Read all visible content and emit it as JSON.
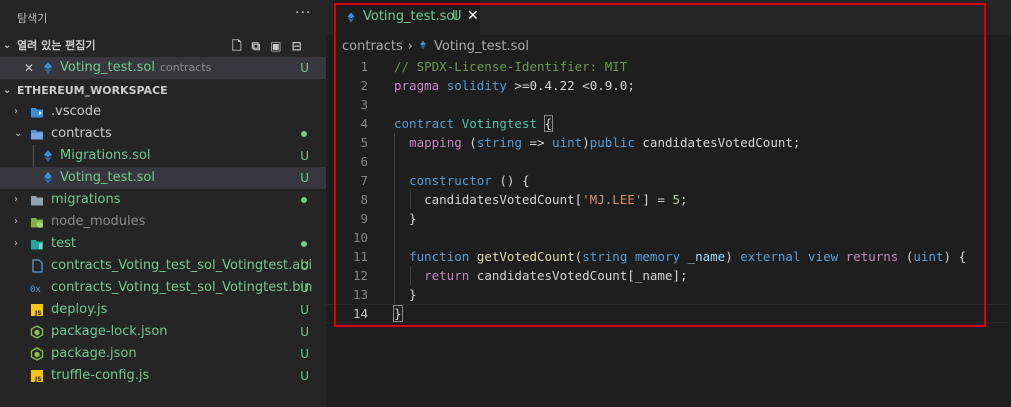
{
  "explorer": {
    "title": "탐색기",
    "more": "···",
    "open_editors": {
      "label": "열려 있는 편집기",
      "items": [
        {
          "close": "✕",
          "name": "Voting_test.sol",
          "desc": "contracts",
          "badge": "U"
        }
      ]
    },
    "workspace": {
      "label": "ETHEREUM_WORKSPACE",
      "items": [
        {
          "name": ".vscode",
          "badge": ""
        },
        {
          "name": "contracts",
          "badge": ""
        },
        {
          "name": "Migrations.sol",
          "badge": "U"
        },
        {
          "name": "Voting_test.sol",
          "badge": "U"
        },
        {
          "name": "migrations",
          "badge": ""
        },
        {
          "name": "node_modules",
          "badge": ""
        },
        {
          "name": "test",
          "badge": ""
        },
        {
          "name": "contracts_Voting_test_sol_Votingtest.abi",
          "badge": "U"
        },
        {
          "name": "contracts_Voting_test_sol_Votingtest.bin",
          "badge": "U"
        },
        {
          "name": "deploy.js",
          "badge": "U"
        },
        {
          "name": "package-lock.json",
          "badge": "U"
        },
        {
          "name": "package.json",
          "badge": "U"
        },
        {
          "name": "truffle-config.js",
          "badge": "U"
        }
      ]
    }
  },
  "editor": {
    "tab": {
      "label": "Voting_test.sol",
      "status": "U",
      "close": "✕"
    },
    "breadcrumb": {
      "folder": "contracts",
      "file": "Voting_test.sol"
    },
    "line_numbers": [
      "1",
      "2",
      "3",
      "4",
      "5",
      "6",
      "7",
      "8",
      "9",
      "10",
      "11",
      "12",
      "13",
      "14"
    ]
  },
  "colors": {
    "accent_untracked": "#73c991",
    "highlight_box": "#e00000",
    "solidity_icon": "#3c8fd6"
  }
}
